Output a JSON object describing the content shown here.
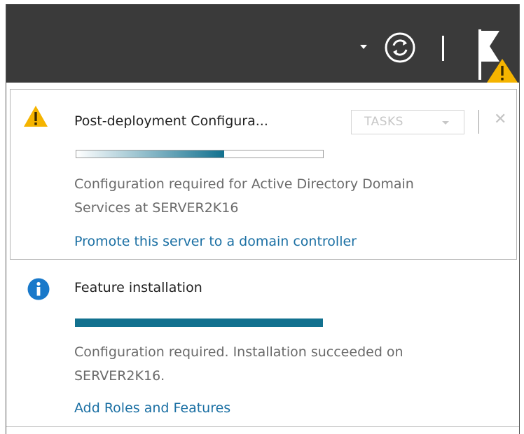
{
  "toolbar": {
    "dropdown_icon": "chevron-down-icon",
    "refresh_icon": "refresh-icon",
    "flag_icon": "notification-flag-icon",
    "warning_overlay_icon": "warning-icon"
  },
  "notifications": [
    {
      "icon": "warning-icon",
      "title": "Post-deployment Configura...",
      "tasks_label": "TASKS",
      "close_glyph": "✕",
      "progress": 0.6,
      "description_line1": "Configuration required for Active Directory Domain",
      "description_line2": "Services at SERVER2K16",
      "link": "Promote this server to a domain controller"
    },
    {
      "icon": "info-icon",
      "title": "Feature installation",
      "progress": 1.0,
      "description_line1": "Configuration required. Installation succeeded on",
      "description_line2": "SERVER2K16.",
      "link": "Add Roles and Features"
    }
  ],
  "colors": {
    "topbar": "#3a3a3a",
    "progress": "#12718f",
    "link": "#1a6fa3",
    "warning": "#f5b400",
    "info": "#1979ca"
  }
}
